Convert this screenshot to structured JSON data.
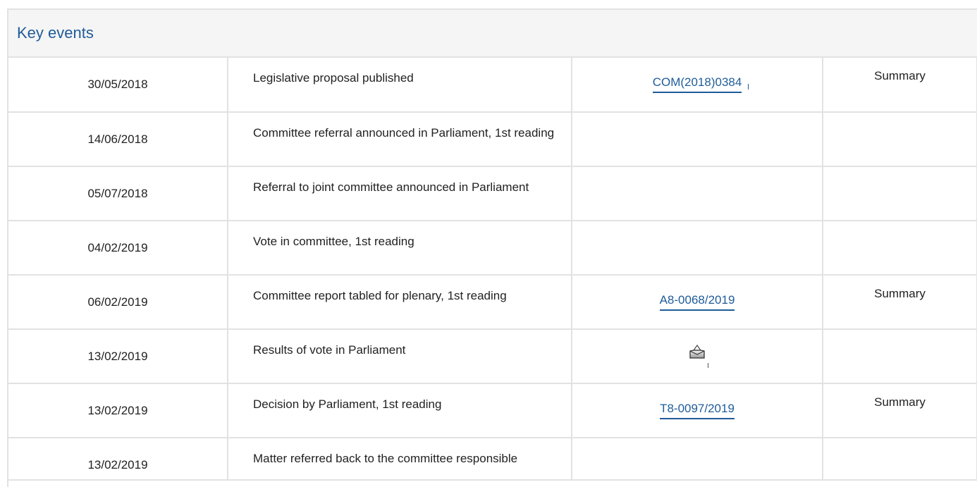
{
  "panel": {
    "title": "Key events"
  },
  "rows": [
    {
      "date": "30/05/2018",
      "event": "Legislative proposal published",
      "doc": "COM(2018)0384",
      "summary": "Summary"
    },
    {
      "date": "14/06/2018",
      "event": "Committee referral announced in Parliament, 1st reading",
      "doc": "",
      "summary": ""
    },
    {
      "date": "05/07/2018",
      "event": "Referral to joint committee announced in Parliament",
      "doc": "",
      "summary": ""
    },
    {
      "date": "04/02/2019",
      "event": "Vote in committee, 1st reading",
      "doc": "",
      "summary": ""
    },
    {
      "date": "06/02/2019",
      "event": "Committee report tabled for plenary, 1st reading",
      "doc": "A8-0068/2019",
      "summary": "Summary"
    },
    {
      "date": "13/02/2019",
      "event": "Results of vote in Parliament",
      "doc": "",
      "doc_icon": "ballot-box-icon",
      "summary": ""
    },
    {
      "date": "13/02/2019",
      "event": "Decision by Parliament, 1st reading",
      "doc": "T8-0097/2019",
      "summary": "Summary"
    },
    {
      "date": "13/02/2019",
      "event": "Matter referred back to the committee responsible",
      "doc": "",
      "summary": ""
    }
  ],
  "colors": {
    "link": "#1f5c99",
    "border": "#e2e2e2",
    "header_bg": "#f5f5f5"
  }
}
